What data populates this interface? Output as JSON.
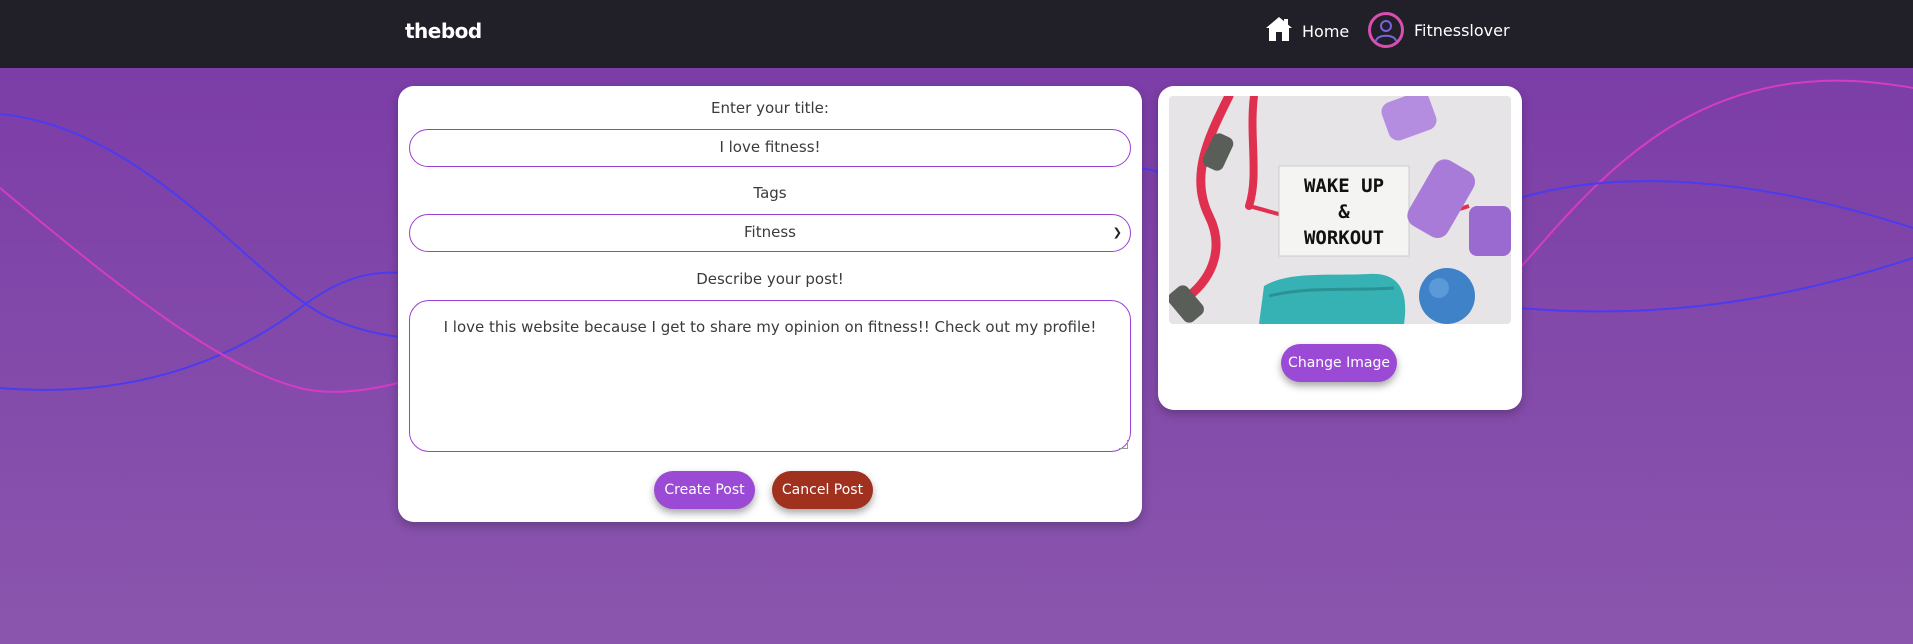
{
  "nav": {
    "brand": "thebod",
    "home_label": "Home",
    "username": "Fitnesslover",
    "home_icon": "home-icon",
    "avatar_icon": "user-icon",
    "avatar_ring_color": "#d94fb0"
  },
  "form": {
    "title_label": "Enter your title:",
    "title_value": "I love fitness!",
    "tags_label": "Tags",
    "tags_selected": "Fitness",
    "description_label": "Describe your post!",
    "description_value": "I love this website because I get to share my opinion on fitness!! Check out my profile!",
    "create_button": "Create Post",
    "cancel_button": "Cancel Post"
  },
  "image_panel": {
    "lightbox_line1": "WAKE UP",
    "lightbox_line2": "&",
    "lightbox_line3": "WORKOUT",
    "change_button": "Change Image"
  },
  "colors": {
    "navbar": "#211f27",
    "accent_purple": "#9b4ad6",
    "cancel_red": "#a1311f",
    "background_top": "#7a3aa6",
    "background_bottom": "#8a56ad"
  }
}
